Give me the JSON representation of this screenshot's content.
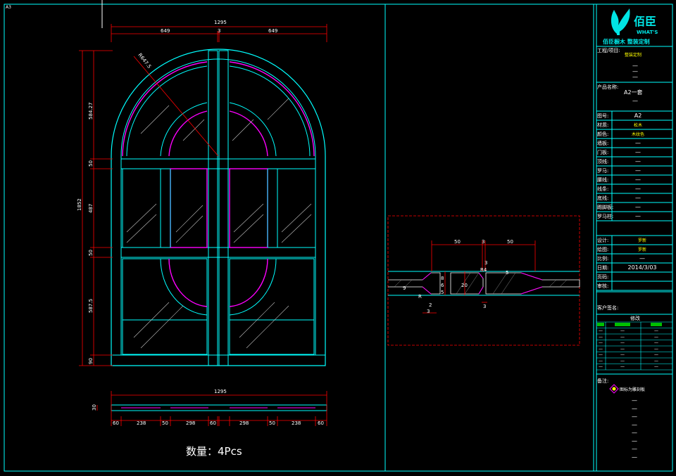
{
  "sheet": {
    "sheet_tag": "A3",
    "quantity": "数量：4Pcs"
  },
  "title_block": {
    "logo_main": "佰臣",
    "logo_sub": "WHAT'S",
    "slogan": "佰臣橱木  整装定制",
    "project_label": "工程/项目:",
    "project_value": "整装定制",
    "project_dashes": [
      "—",
      "—",
      "—"
    ],
    "product_label": "产品名称:",
    "product_value": "A2一套",
    "product_dash": "—",
    "rows": [
      {
        "label": "图号:",
        "value": "A2"
      },
      {
        "label": "材质:",
        "value": "松木"
      },
      {
        "label": "颜色:",
        "value": "木纹色"
      },
      {
        "label": "墙板:",
        "value": "—"
      },
      {
        "label": "门板:",
        "value": "—"
      },
      {
        "label": "顶线:",
        "value": "—"
      },
      {
        "label": "罗马:",
        "value": "—"
      },
      {
        "label": "腰线:",
        "value": "—"
      },
      {
        "label": "线条:",
        "value": "—"
      },
      {
        "label": "底线:",
        "value": "—"
      },
      {
        "label": "踢脚板:",
        "value": "—"
      },
      {
        "label": "罗马柱:",
        "value": "—"
      }
    ],
    "rows2": [
      {
        "label": "设计:",
        "value": "罗新"
      },
      {
        "label": "绘图:",
        "value": "罗新"
      },
      {
        "label": "比例:",
        "value": "—"
      },
      {
        "label": "日期:",
        "value": "2014/3/03"
      },
      {
        "label": "页码:",
        "value": ""
      },
      {
        "label": "审核:",
        "value": ""
      }
    ],
    "customer_label": "客户签名:",
    "revision_header": "修改",
    "remarks_label": "备注:",
    "remarks_note": "图标为雕刻板",
    "remark_dashes": [
      "—",
      "—",
      "—",
      "—",
      "—",
      "—",
      "—",
      "—"
    ]
  },
  "door": {
    "top_width": "1295",
    "top_left": "649",
    "top_gap": "3",
    "top_right": "649",
    "radius": "R647.5",
    "total_height": "1852",
    "h_segments": [
      "584.27",
      "50",
      "487",
      "50",
      "587.5",
      "90"
    ],
    "bottom_width": "1295",
    "bottom_thickness": "30",
    "bottom_segments": [
      "60",
      "238",
      "50",
      "298",
      "60",
      "298",
      "50",
      "238",
      "60"
    ]
  },
  "section": {
    "top_dims": [
      "50",
      "3",
      "50"
    ],
    "dims_misc": [
      "3",
      "R4",
      "5",
      "2",
      "9",
      "R",
      "3",
      "3",
      "8",
      "6",
      "5",
      "20",
      "2",
      "6",
      "3",
      "R4"
    ]
  },
  "colors": {
    "frame": "#00ffff",
    "panel": "#ff00ff",
    "dimension": "#ff0000",
    "text": "#ffffff",
    "highlight": "#ffff00",
    "leaf": "#00e5e5"
  }
}
